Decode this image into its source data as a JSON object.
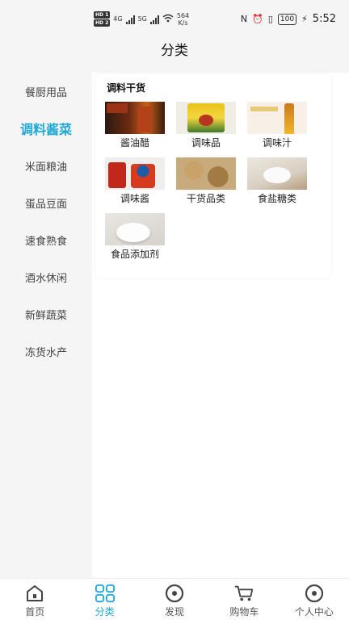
{
  "status_bar": {
    "hd1": "HD 1",
    "hd2": "HD 2",
    "net1": "4G",
    "net2": "5G",
    "speed_value": "564",
    "speed_unit": "K/s",
    "battery": "100",
    "time": "5:52"
  },
  "page_title": "分类",
  "sidebar": {
    "active_index": 1,
    "items": [
      {
        "label": "餐厨用品"
      },
      {
        "label": "调料酱菜"
      },
      {
        "label": "米面粮油"
      },
      {
        "label": "蛋品豆面"
      },
      {
        "label": "速食熟食"
      },
      {
        "label": "酒水休闲"
      },
      {
        "label": "新鲜蔬菜"
      },
      {
        "label": "冻货水产"
      }
    ]
  },
  "section": {
    "title": "调料干货",
    "items": [
      {
        "label": "酱油醋",
        "image": "soy-sauce-vinegar-photo"
      },
      {
        "label": "调味品",
        "image": "seasoning-photo"
      },
      {
        "label": "调味汁",
        "image": "sauce-bottle-photo"
      },
      {
        "label": "调味酱",
        "image": "condiment-jar-photo"
      },
      {
        "label": "干货品类",
        "image": "dried-goods-photo"
      },
      {
        "label": "食盐糖类",
        "image": "salt-sugar-photo"
      },
      {
        "label": "食品添加剂",
        "image": "food-additive-photo"
      }
    ]
  },
  "bottom_nav": {
    "active_index": 1,
    "items": [
      {
        "label": "首页",
        "icon": "home-icon"
      },
      {
        "label": "分类",
        "icon": "category-grid-icon"
      },
      {
        "label": "发现",
        "icon": "discover-icon"
      },
      {
        "label": "购物车",
        "icon": "cart-icon"
      },
      {
        "label": "个人中心",
        "icon": "profile-icon"
      }
    ]
  },
  "colors": {
    "accent": "#1fa8d8",
    "background": "#f5f5f5",
    "panel": "#ffffff"
  }
}
